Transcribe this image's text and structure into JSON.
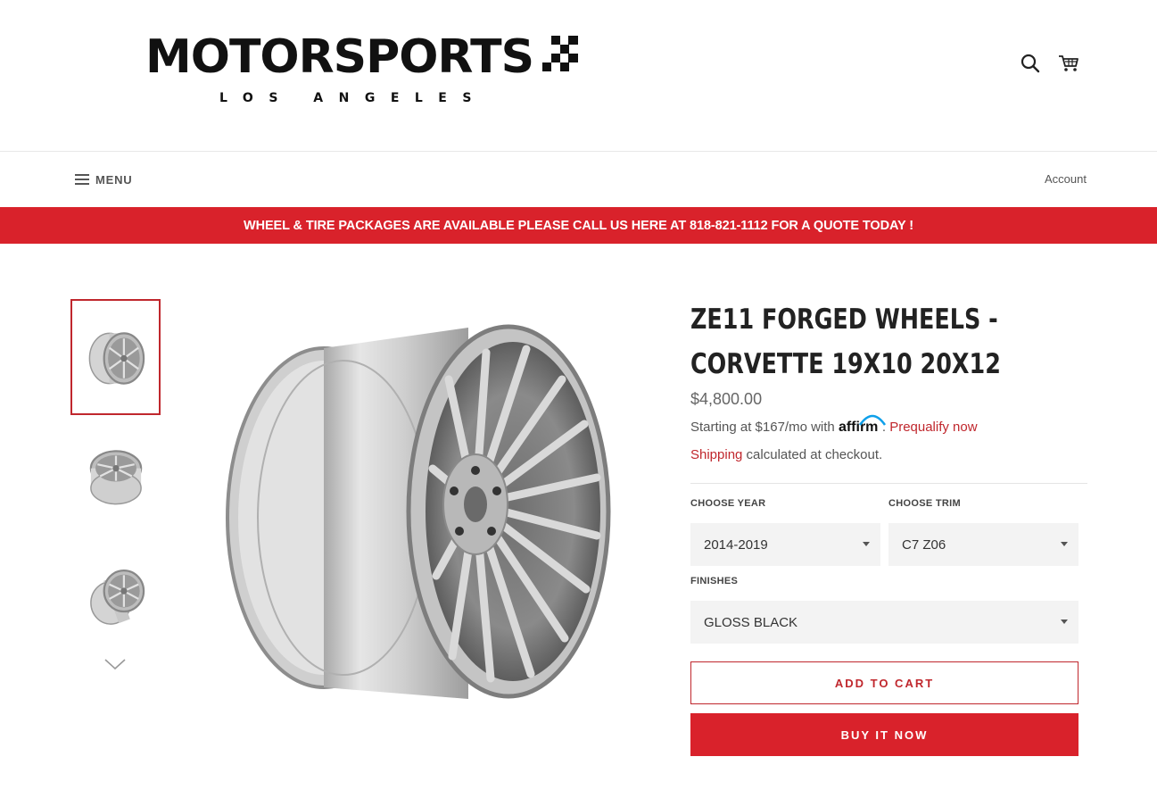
{
  "brand": {
    "name": "MOTORSPORTS",
    "location": "LOS ANGELES"
  },
  "header": {
    "search_icon": "search-icon",
    "cart_icon": "cart-icon"
  },
  "nav": {
    "menu_label": "MENU",
    "account_label": "Account"
  },
  "banner": {
    "text": "WHEEL & TIRE PACKAGES ARE AVAILABLE PLEASE CALL US HERE AT 818-821-1112 FOR A QUOTE TODAY !"
  },
  "product": {
    "title_line1": "ZE11 FORGED WHEELS -",
    "title_line2": "CORVETTE 19X10 20X12",
    "price": "$4,800.00",
    "financing": {
      "prefix": "Starting at $167/mo with",
      "provider": "affirm",
      "suffix": ".",
      "link": "Prequalify now"
    },
    "shipping": {
      "link": "Shipping",
      "text": " calculated at checkout."
    },
    "options": {
      "year": {
        "label": "CHOOSE YEAR",
        "value": "2014-2019"
      },
      "trim": {
        "label": "CHOOSE TRIM",
        "value": "C7 Z06"
      },
      "finish": {
        "label": "FINISHES",
        "value": "GLOSS BLACK"
      }
    },
    "buttons": {
      "add_to_cart": "ADD TO CART",
      "buy_now": "BUY IT NOW"
    }
  },
  "colors": {
    "accent": "#d9222b",
    "accent_dark": "#c0272d",
    "text": "#333333",
    "field_bg": "#f3f3f3"
  }
}
